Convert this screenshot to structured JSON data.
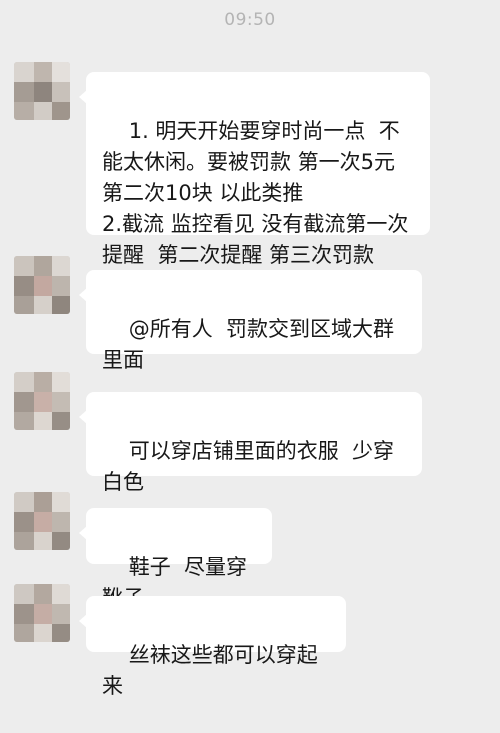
{
  "status_time": "09:50",
  "messages": [
    {
      "text": "1. 明天开始要穿时尚一点  不能太休闲。要被罚款 第一次5元 第二次10块 以此类推\n2.截流 监控看见 没有截流第一次提醒  第二次提醒 第三次罚款"
    },
    {
      "text": "@所有人  罚款交到区域大群里面"
    },
    {
      "text": "可以穿店铺里面的衣服  少穿白色"
    },
    {
      "text": "鞋子  尽量穿靴子"
    },
    {
      "text": "丝袜这些都可以穿起来"
    }
  ],
  "colors": {
    "background": "#ededed",
    "bubble": "#ffffff",
    "text": "#181818",
    "timestamp": "#b4b4b4"
  }
}
